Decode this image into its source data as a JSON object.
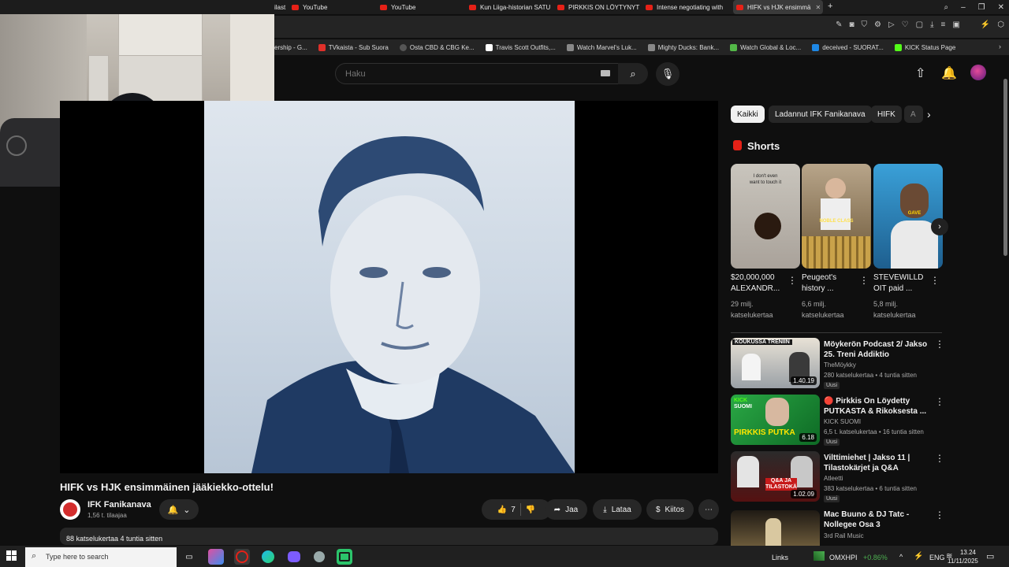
{
  "browser": {
    "tabs": [
      {
        "label": "ilast"
      },
      {
        "label": "YouTube"
      },
      {
        "label": "YouTube"
      },
      {
        "label": "Kun Liiga-historian SATU"
      },
      {
        "label": "PIRKKIS ON LÖYTYNYT! K"
      },
      {
        "label": "Intense negotiating with"
      },
      {
        "label": "HIFK vs HJK ensimmä",
        "active": true
      }
    ],
    "new_tab": "+",
    "window_controls": {
      "search": "⌕",
      "minimize": "–",
      "restore": "❐",
      "close": "✕"
    },
    "bookmarks": [
      {
        "label": "ership - G...",
        "color": "#4a4a4a"
      },
      {
        "label": "TVkaista - Sub Suora",
        "color": "#e0302a"
      },
      {
        "label": "Osta CBD & CBG Ke...",
        "color": "#555555"
      },
      {
        "label": "Travis Scott Outfits,...",
        "color": "#ffffff"
      },
      {
        "label": "Watch Marvel's Luk...",
        "color": "#888888"
      },
      {
        "label": "Mighty Ducks: Bank...",
        "color": "#888888"
      },
      {
        "label": "Watch Global & Loc...",
        "color": "#53b848"
      },
      {
        "label": "deceived - SUORAT...",
        "color": "#1e88e5"
      },
      {
        "label": "KICK Status Page",
        "color": "#53fc18"
      }
    ]
  },
  "youtube": {
    "search": {
      "placeholder": "Haku",
      "value": ""
    },
    "video": {
      "title": "HIFK vs HJK ensimmäinen jääkiekko-ottelu!",
      "channel": "IFK Fanikanava",
      "subscribers": "1,56 t. tilaajaa",
      "likes": "7",
      "share_label": "Jaa",
      "download_label": "Lataa",
      "thanks_label": "Kiitos",
      "views_age": "88 katselukertaa  4 tuntia sitten"
    },
    "chips": [
      {
        "label": "Kaikki",
        "selected": true
      },
      {
        "label": "Ladannut IFK Fanikanava"
      },
      {
        "label": "HIFK"
      },
      {
        "label": "A"
      }
    ],
    "shorts": {
      "title": "Shorts",
      "items": [
        {
          "title": "$20,000,000 ALEXANDR...",
          "views": "29 milj. katselukertaa"
        },
        {
          "title": "Peugeot's history ...",
          "views": "6,6 milj. katselukertaa"
        },
        {
          "title": "STEVEWILLD OIT paid ...",
          "views": "5,8 milj. katselukertaa"
        }
      ]
    },
    "recommended": [
      {
        "title": "Möykerön Podcast 2/ Jakso 25. Treni Addiktio",
        "channel": "TheMöykky",
        "meta": "280 katselukertaa • 4 tuntia sitten",
        "badge": "Uusi",
        "duration": "1.40.19"
      },
      {
        "title": "🔴 Pirkkis On Löydetty PUTKASTA & Rikoksesta ...",
        "channel": "KICK SUOMI",
        "meta": "6,5 t. katselukertaa • 16 tuntia sitten",
        "badge": "Uusi",
        "duration": "6.18"
      },
      {
        "title": "Vilttimiehet | Jakso 11 | Tilastokärjet ja Q&A",
        "channel": "Atleetti",
        "meta": "383 katselukertaa • 6 tuntia sitten",
        "badge": "Uusi",
        "duration": "1.02.09"
      },
      {
        "title": "Mac Buuno & DJ Tatc - Nollegee Osa 3",
        "channel": "3rd Rail Music",
        "meta": "",
        "badge": "",
        "duration": ""
      }
    ]
  },
  "thumb_texts": {
    "short1": "I don't even want to touch it",
    "short2": "NOBLE CLASS",
    "short3": "GAVE",
    "rec1": "KOUKUSSA TRENIIN",
    "rec2_brand": "KICK",
    "rec2_sub": "SUOMI",
    "rec2": "PIRKKIS PUTKA",
    "rec3": "Q&A JA TILASTOKÄ"
  },
  "taskbar": {
    "search_placeholder": "Type here to search",
    "links": "Links",
    "ticker": "OMXHPI",
    "ticker_change": "+0.86%",
    "lang": "ENG",
    "time": "13.24",
    "date": "11/11/2025"
  },
  "colors": {
    "bg": "#0f0f0f",
    "accent_red": "#e62117",
    "chip_bg": "#272727",
    "ticker_green": "#4caf50"
  }
}
